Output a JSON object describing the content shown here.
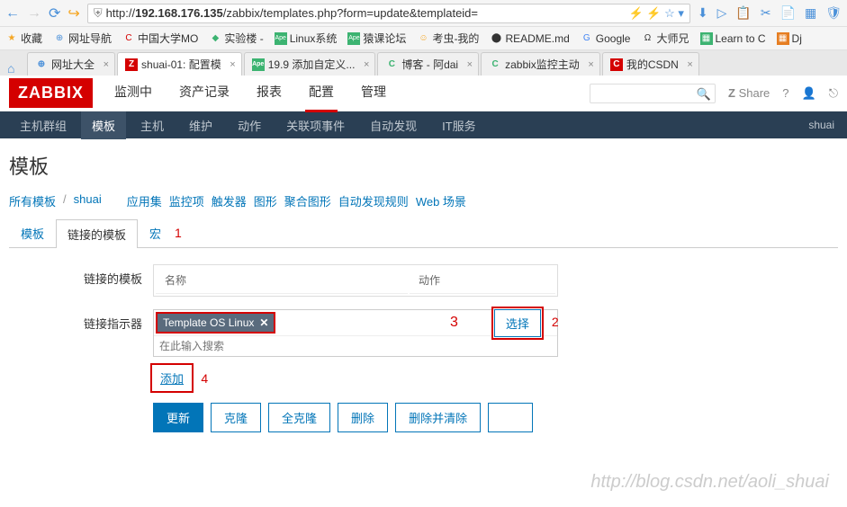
{
  "browser": {
    "url_prefix": "http://",
    "url_host": "192.168.176.135",
    "url_path": "/zabbix/templates.php?form=update&templateid=",
    "bookmarks": [
      {
        "label": "收藏",
        "icon": "★",
        "color": "#f5a623"
      },
      {
        "label": "网址导航",
        "icon": "⊕",
        "color": "#4a90d9"
      },
      {
        "label": "中国大学MO",
        "icon": "C",
        "color": "#d40000"
      },
      {
        "label": "实验楼 -",
        "icon": "◆",
        "color": "#3cb371"
      },
      {
        "label": "Linux系统",
        "icon": "Ape",
        "color": "#3cb371"
      },
      {
        "label": "猿课论坛",
        "icon": "Ape",
        "color": "#3cb371"
      },
      {
        "label": "考虫-我的",
        "icon": "☺",
        "color": "#f5a623"
      },
      {
        "label": "README.md",
        "icon": "⬤",
        "color": "#333"
      },
      {
        "label": "Google",
        "icon": "G",
        "color": "#4285f4"
      },
      {
        "label": "大师兄",
        "icon": "Ω",
        "color": "#333"
      },
      {
        "label": "Learn to C",
        "icon": "▦",
        "color": "#3cb371"
      },
      {
        "label": "Dj",
        "icon": "▦",
        "color": "#e67e22"
      }
    ],
    "tabs": [
      {
        "label": "网址大全",
        "icon": "⊕",
        "color": "#4a90d9",
        "active": false
      },
      {
        "label": "shuai-01: 配置模",
        "icon": "Z",
        "color": "#d40000",
        "active": true
      },
      {
        "label": "19.9 添加自定义...",
        "icon": "Ape",
        "color": "#3cb371",
        "active": false
      },
      {
        "label": "博客 - 阿dai",
        "icon": "C",
        "color": "#3cb371",
        "active": false
      },
      {
        "label": "zabbix监控主动",
        "icon": "C",
        "color": "#3cb371",
        "active": false
      },
      {
        "label": "我的CSDN",
        "icon": "C",
        "color": "#d40000",
        "active": false
      }
    ]
  },
  "zabbix": {
    "logo": "ZABBIX",
    "main_nav": [
      "监测中",
      "资产记录",
      "报表",
      "配置",
      "管理"
    ],
    "main_nav_active": 3,
    "share": "Share",
    "sub_nav": [
      "主机群组",
      "模板",
      "主机",
      "维护",
      "动作",
      "关联项事件",
      "自动发现",
      "IT服务"
    ],
    "sub_nav_active": 1,
    "sub_nav_right": "shuai",
    "page_title": "模板",
    "breadcrumb": [
      "所有模板",
      "shuai",
      "应用集",
      "监控项",
      "触发器",
      "图形",
      "聚合图形",
      "自动发现规则",
      "Web 场景"
    ],
    "config_tabs": [
      "模板",
      "链接的模板",
      "宏"
    ],
    "config_tab_active": 1,
    "form": {
      "linked_label": "链接的模板",
      "col_name": "名称",
      "col_action": "动作",
      "indicator_label": "链接指示器",
      "tag": "Template OS Linux",
      "search_placeholder": "在此输入搜索",
      "select_btn": "选择",
      "add_link": "添加"
    },
    "actions": {
      "update": "更新",
      "clone": "克隆",
      "full_clone": "全克隆",
      "delete": "删除",
      "delete_clear": "删除并清除"
    }
  },
  "annotations": {
    "a1": "1",
    "a2": "2",
    "a3": "3",
    "a4": "4"
  },
  "watermark": "http://blog.csdn.net/aoli_shuai"
}
